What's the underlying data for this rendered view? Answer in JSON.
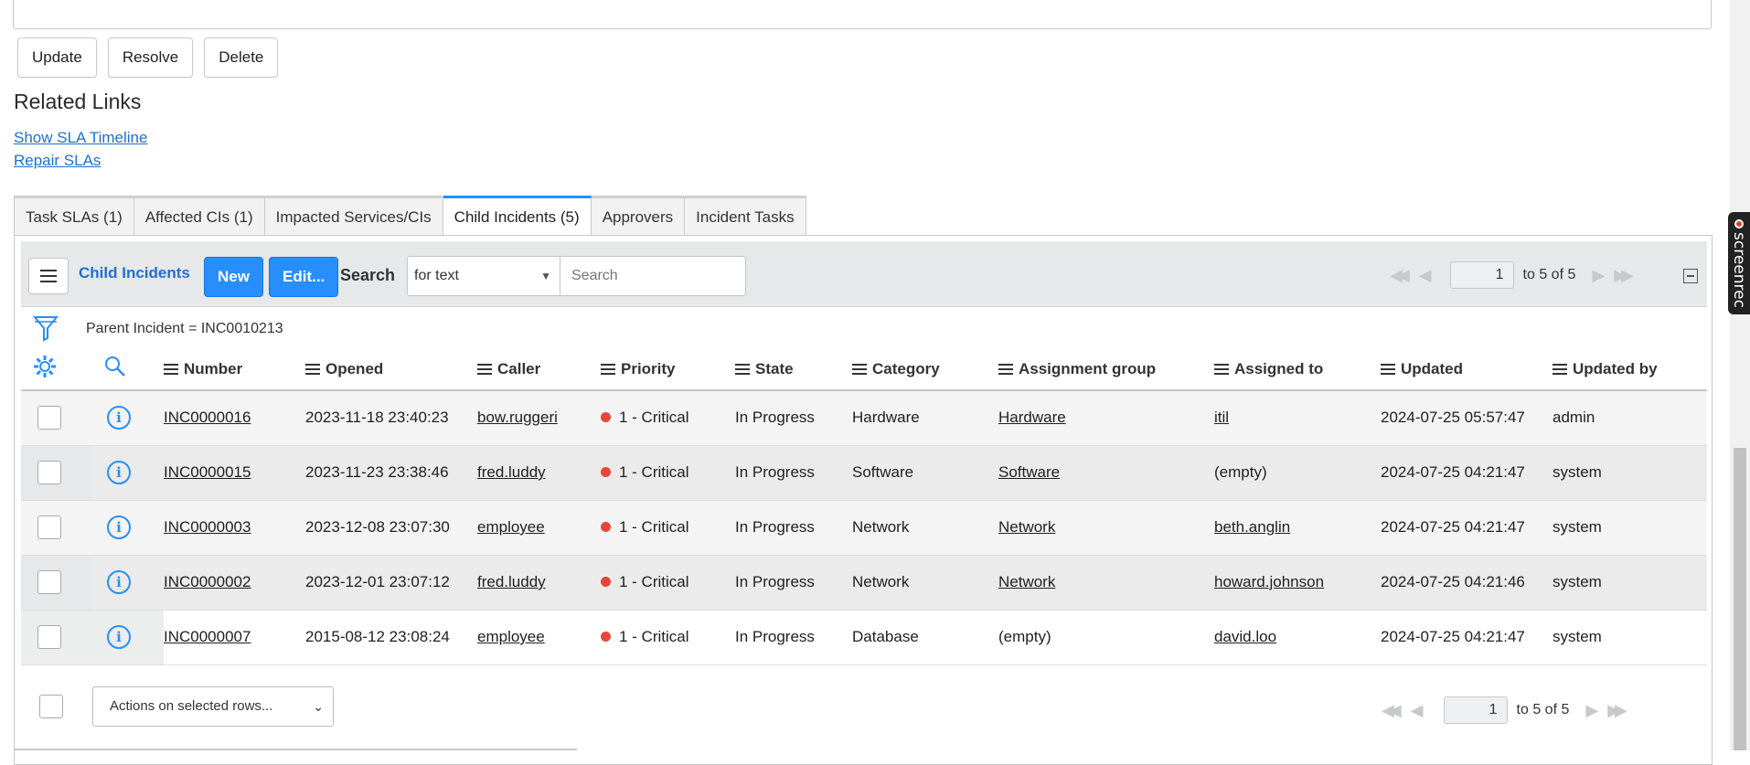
{
  "form_buttons": {
    "update": "Update",
    "resolve": "Resolve",
    "delete": "Delete"
  },
  "related_links": {
    "title": "Related Links",
    "links": [
      "Show SLA Timeline",
      "Repair SLAs"
    ]
  },
  "tabs": [
    "Task SLAs (1)",
    "Affected CIs (1)",
    "Impacted Services/CIs",
    "Child Incidents (5)",
    "Approvers",
    "Incident Tasks"
  ],
  "active_tab_index": 3,
  "list": {
    "title": "Child Incidents",
    "new_label": "New",
    "edit_label": "Edit...",
    "search_label": "Search",
    "search_scope": "for text",
    "search_placeholder": "Search",
    "page_current": "1",
    "page_of": "to 5 of 5",
    "filter": "Parent Incident = INC0010213"
  },
  "columns": [
    "Number",
    "Opened",
    "Caller",
    "Priority",
    "State",
    "Category",
    "Assignment group",
    "Assigned to",
    "Updated",
    "Updated by"
  ],
  "rows": [
    {
      "number": "INC0000016",
      "opened": "2023-11-18 23:40:23",
      "caller": "bow.ruggeri",
      "priority": "1 - Critical",
      "state": "In Progress",
      "category": "Hardware",
      "group": "Hardware",
      "assigned": "itil",
      "updated": "2024-07-25 05:57:47",
      "updated_by": "admin"
    },
    {
      "number": "INC0000015",
      "opened": "2023-11-23 23:38:46",
      "caller": "fred.luddy",
      "priority": "1 - Critical",
      "state": "In Progress",
      "category": "Software",
      "group": "Software",
      "assigned": "(empty)",
      "updated": "2024-07-25 04:21:47",
      "updated_by": "system"
    },
    {
      "number": "INC0000003",
      "opened": "2023-12-08 23:07:30",
      "caller": "employee",
      "priority": "1 - Critical",
      "state": "In Progress",
      "category": "Network",
      "group": "Network",
      "assigned": "beth.anglin",
      "updated": "2024-07-25 04:21:47",
      "updated_by": "system"
    },
    {
      "number": "INC0000002",
      "opened": "2023-12-01 23:07:12",
      "caller": "fred.luddy",
      "priority": "1 - Critical",
      "state": "In Progress",
      "category": "Network",
      "group": "Network",
      "assigned": "howard.johnson",
      "updated": "2024-07-25 04:21:46",
      "updated_by": "system"
    },
    {
      "number": "INC0000007",
      "opened": "2015-08-12 23:08:24",
      "caller": "employee",
      "priority": "1 - Critical",
      "state": "In Progress",
      "category": "Database",
      "group": "(empty)",
      "assigned": "david.loo",
      "updated": "2024-07-25 04:21:47",
      "updated_by": "system"
    }
  ],
  "footer": {
    "actions_label": "Actions on selected rows...",
    "page_current": "1",
    "page_of": "to 5 of 5"
  },
  "screenrec_label": "screenrec",
  "colors": {
    "accent": "#278efc",
    "link": "#1f6fd1",
    "critical": "#e8463a"
  }
}
